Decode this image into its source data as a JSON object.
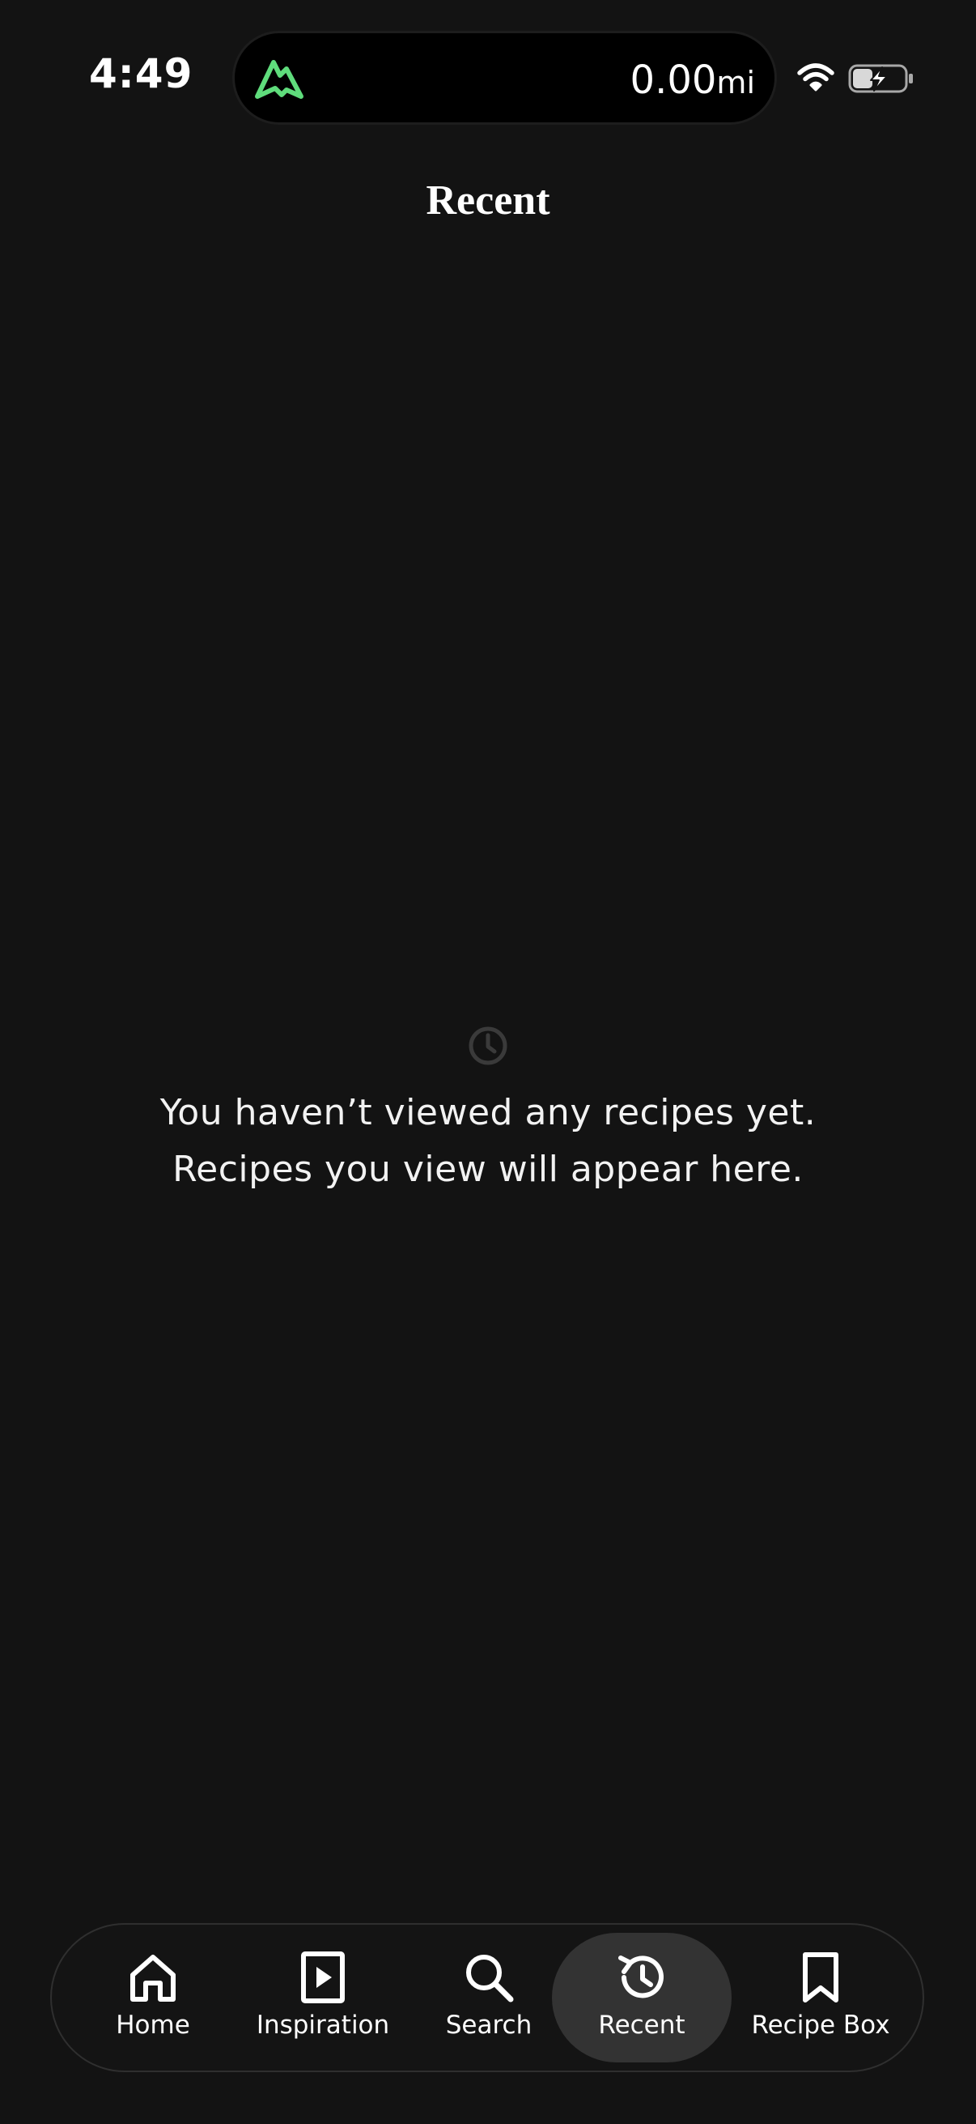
{
  "status_bar": {
    "time": "4:49",
    "distance_value": "0.00",
    "distance_unit": "mi",
    "logo_color": "#5fdc7c"
  },
  "header": {
    "title": "Recent"
  },
  "empty_state": {
    "icon": "clock-icon",
    "line1": "You haven’t viewed any recipes yet.",
    "line2": "Recipes you view will appear here."
  },
  "tabs": [
    {
      "label": "Home",
      "icon": "home-icon",
      "active": false
    },
    {
      "label": "Inspiration",
      "icon": "play-icon",
      "active": false
    },
    {
      "label": "Search",
      "icon": "search-icon",
      "active": false
    },
    {
      "label": "Recent",
      "icon": "history-icon",
      "active": true
    },
    {
      "label": "Recipe Box",
      "icon": "bookmark-icon",
      "active": false
    }
  ],
  "colors": {
    "background": "#131313",
    "active_tab": "#333333",
    "accent_green": "#5fdc7c"
  }
}
